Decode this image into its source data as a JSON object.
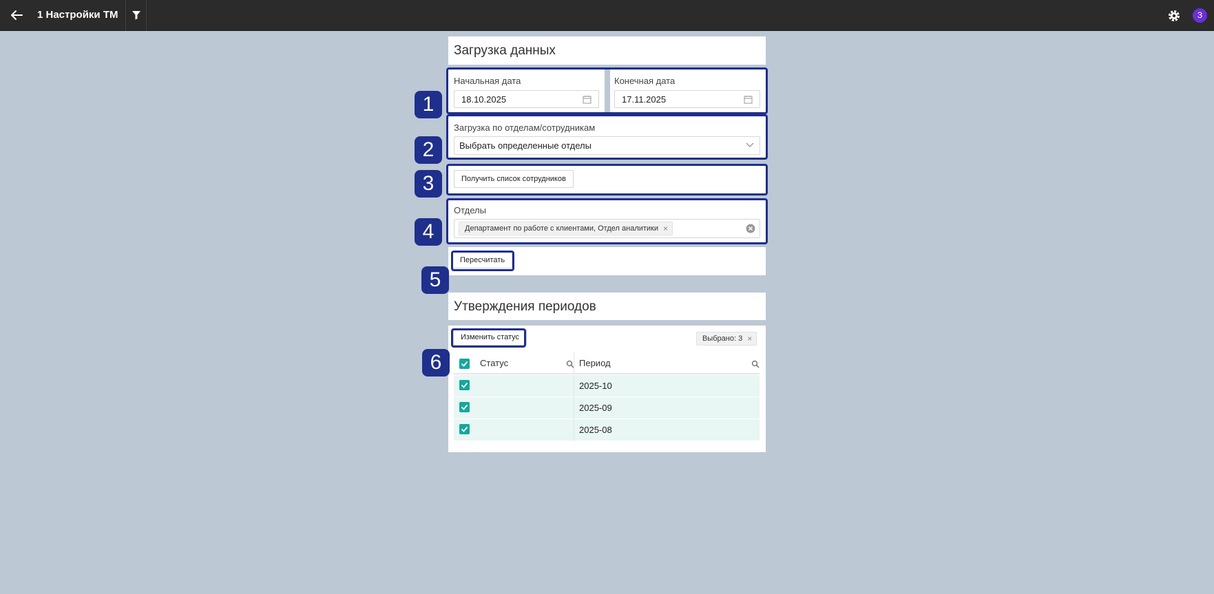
{
  "topbar": {
    "title": "1 Настройки ТМ",
    "avatar_letter": "З",
    "avatar_color": "#6b2fd6"
  },
  "upload": {
    "title": "Загрузка данных",
    "start_date_label": "Начальная дата",
    "start_date_value": "18.10.2025",
    "end_date_label": "Конечная дата",
    "end_date_value": "17.11.2025",
    "mode_label": "Загрузка по отделам/сотрудникам",
    "mode_value": "Выбрать определенные отделы",
    "get_employees_button": "Получить список сотрудников",
    "departments_label": "Отделы",
    "departments_tag": "Департамент по работе с клиентами, Отдел аналитики",
    "recalc_button": "Пересчитать"
  },
  "approvals": {
    "title": "Утверждения периодов",
    "change_status_button": "Изменить статус",
    "selected_tag": "Выбрано: 3",
    "columns": [
      "Статус",
      "Период"
    ],
    "rows": [
      {
        "status": "",
        "period": "2025-10",
        "checked": true
      },
      {
        "status": "",
        "period": "2025-09",
        "checked": true
      },
      {
        "status": "",
        "period": "2025-08",
        "checked": true
      }
    ]
  },
  "callouts": [
    "1",
    "2",
    "3",
    "4",
    "5",
    "6"
  ],
  "colors": {
    "callout": "#1f2f8c",
    "accent": "#13a89e",
    "row_highlight": "#e8f6f4"
  }
}
